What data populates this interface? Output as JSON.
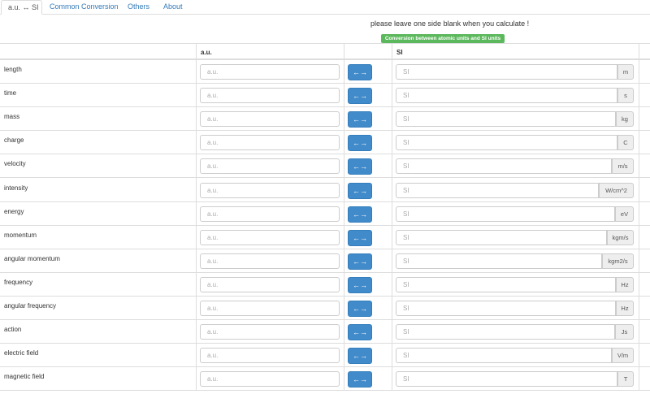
{
  "tabs": [
    {
      "label": "a.u. ↔ SI",
      "active": true
    },
    {
      "label": "Common Conversion",
      "active": false
    },
    {
      "label": "Others",
      "active": false
    },
    {
      "label": "About",
      "active": false
    }
  ],
  "notice": "please leave one side blank when you calculate !",
  "badge": "Conversion between atomic units and SI units",
  "table": {
    "header_au": "a.u.",
    "header_si": "SI",
    "au_placeholder": "a.u.",
    "si_placeholder": "SI",
    "convert_label": "←→",
    "rows": [
      {
        "name": "length",
        "unit": "m"
      },
      {
        "name": "time",
        "unit": "s"
      },
      {
        "name": "mass",
        "unit": "kg"
      },
      {
        "name": "charge",
        "unit": "C"
      },
      {
        "name": "velocity",
        "unit": "m/s"
      },
      {
        "name": "intensity",
        "unit": "W/cm^2"
      },
      {
        "name": "energy",
        "unit": "eV"
      },
      {
        "name": "momentum",
        "unit": "kgm/s"
      },
      {
        "name": "angular momentum",
        "unit": "kgm2/s"
      },
      {
        "name": "frequency",
        "unit": "Hz"
      },
      {
        "name": "angular frequency",
        "unit": "Hz"
      },
      {
        "name": "action",
        "unit": "Js"
      },
      {
        "name": "electric field",
        "unit": "V/m"
      },
      {
        "name": "magnetic field",
        "unit": "T"
      }
    ]
  },
  "colors": {
    "link": "#337ab7",
    "primary_button": "#428bca",
    "badge": "#5cb85c",
    "border": "#ddd"
  }
}
